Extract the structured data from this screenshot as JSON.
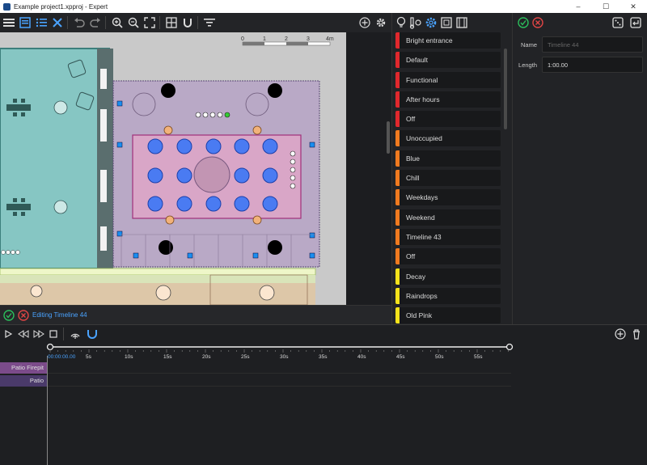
{
  "window": {
    "title": "Example project1.xpproj - Expert"
  },
  "canvas": {
    "scale_ticks": [
      "0",
      "1",
      "2",
      "3",
      "4m"
    ],
    "status_text": "Editing Timeline 44"
  },
  "scenes": [
    {
      "name": "Bright entrance",
      "color": "#e0282d"
    },
    {
      "name": "Default",
      "color": "#e0282d"
    },
    {
      "name": "Functional",
      "color": "#e0282d"
    },
    {
      "name": "After hours",
      "color": "#e0282d"
    },
    {
      "name": "Off",
      "color": "#e0282d"
    },
    {
      "name": "Unoccupied",
      "color": "#f07a1f"
    },
    {
      "name": "Blue",
      "color": "#f07a1f"
    },
    {
      "name": "Chill",
      "color": "#f07a1f"
    },
    {
      "name": "Weekdays",
      "color": "#f07a1f"
    },
    {
      "name": "Weekend",
      "color": "#f07a1f"
    },
    {
      "name": "Timeline 43",
      "color": "#f07a1f"
    },
    {
      "name": "Off",
      "color": "#f07a1f"
    },
    {
      "name": "Decay",
      "color": "#f5e31b"
    },
    {
      "name": "Raindrops",
      "color": "#f5e31b"
    },
    {
      "name": "Old Pink",
      "color": "#f5e31b"
    }
  ],
  "props": {
    "name_label": "Name",
    "name_placeholder": "Timeline 44",
    "length_label": "Length",
    "length_value": "1:00.00"
  },
  "timeline": {
    "current_time": "00:00:00.00",
    "ticks": [
      "5s",
      "10s",
      "15s",
      "20s",
      "25s",
      "30s",
      "35s",
      "40s",
      "45s",
      "50s",
      "55s"
    ],
    "tracks": [
      {
        "label": "Patio Firepit",
        "color": "#7b4b8a"
      },
      {
        "label": "Patio",
        "color": "#4a3a6a"
      }
    ]
  },
  "colors": {
    "accent": "#4aa3ff",
    "ok": "#2bbf5b",
    "cancel": "#e04545"
  }
}
